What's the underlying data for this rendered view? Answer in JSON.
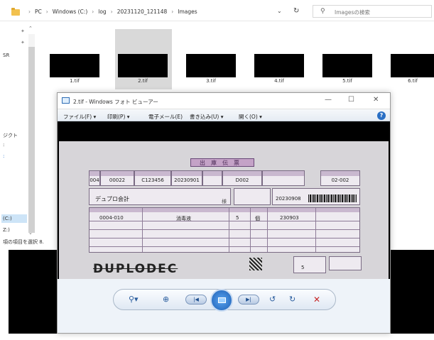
{
  "explorer": {
    "breadcrumb": [
      "PC",
      "Windows (C:)",
      "log",
      "20231120_121148",
      "Images"
    ],
    "search_placeholder": "Imagesの検索",
    "nav_labels": [
      "SR",
      "ジクト",
      "(C:)",
      "Z:)"
    ],
    "status_text": "項の項目を選択 8.",
    "files": [
      "1.tif",
      "2.tif",
      "3.tif",
      "4.tif",
      "5.tif",
      "6.tif"
    ]
  },
  "viewer": {
    "title": "2.tif - Windows フォト ビューアー",
    "menu": [
      "ファイル(F) ▾",
      "印刷(P) ▾",
      "電子メール(E)",
      "書き込み(U) ▾",
      "開く(O) ▾"
    ],
    "help": "?"
  },
  "document": {
    "title": "出庫伝票",
    "row1": [
      "004",
      "00022",
      "C123456",
      "20230901",
      "",
      "D002",
      "",
      "02-002"
    ],
    "customer": "デュプロ会計",
    "sama": "様",
    "date": "20230908",
    "line_item": {
      "code": "0004-010",
      "name": "消毒液",
      "qty": "5",
      "unit": "個",
      "ref": "230903"
    },
    "logo": "DUPLODEC",
    "total_qty": "5"
  },
  "toolbar": {
    "zoom": "⚲▾",
    "fit": "⊕",
    "prev": "|◀",
    "next": "▶|",
    "rot_ccw": "↺",
    "rot_cw": "↻",
    "delete": "✕"
  }
}
